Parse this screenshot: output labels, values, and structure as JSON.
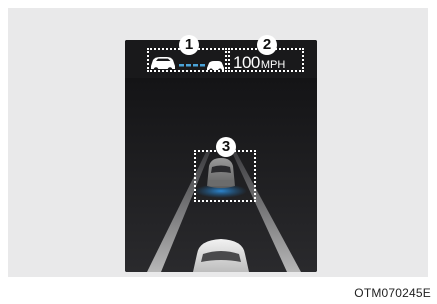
{
  "callouts": [
    {
      "number": "1"
    },
    {
      "number": "2"
    },
    {
      "number": "3"
    }
  ],
  "cluster": {
    "speed_value": "100",
    "speed_unit": "MPH",
    "icons": {
      "own_vehicle": "car-icon",
      "distance_bars": "following-distance-icon",
      "lead_vehicle": "lead-car-icon",
      "target_vehicle": "detected-vehicle-icon"
    },
    "colors": {
      "display_bg": "#141416",
      "distance_bar": "#4aa3d8",
      "lane_lines": "#8a8a8a",
      "detection_glow": "#1f6fb0"
    }
  },
  "figure": {
    "code": "OTM070245E"
  }
}
